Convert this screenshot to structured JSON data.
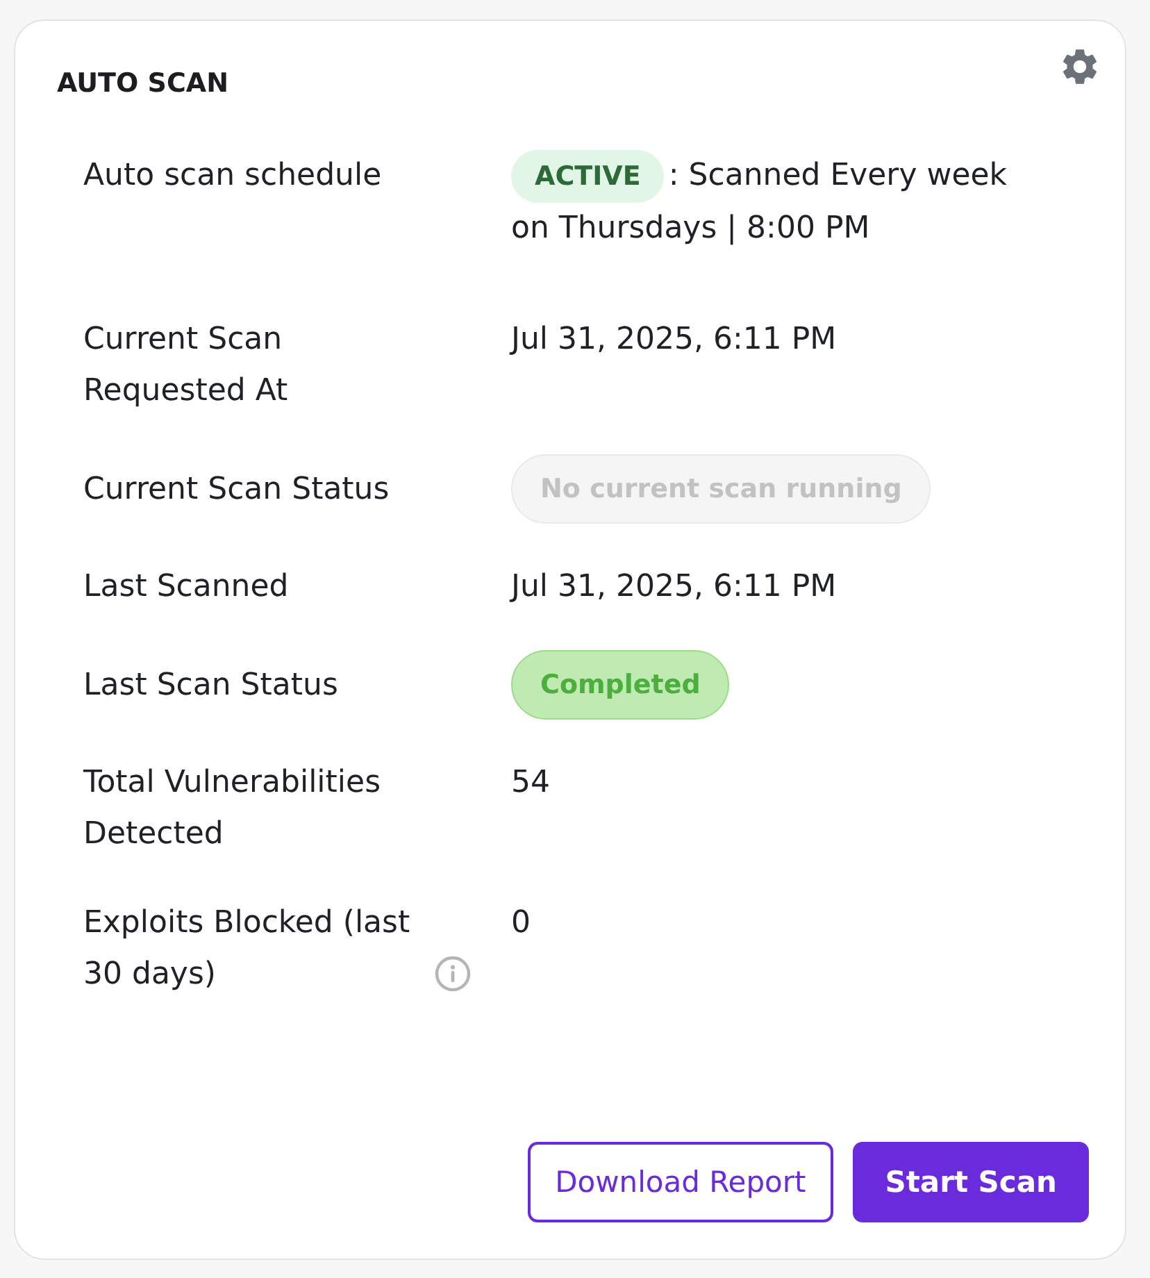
{
  "card": {
    "title": "AUTO SCAN"
  },
  "rows": [
    {
      "kind": "schedule",
      "label": "Auto scan schedule",
      "badge": "ACTIVE",
      "value": ": Scanned Every week on Thursdays | 8:00 PM",
      "info": false
    },
    {
      "kind": "text",
      "label": "Current Scan Requested At",
      "value": "Jul 31, 2025, 6:11 PM",
      "info": false
    },
    {
      "kind": "idle",
      "label": "Current Scan Status",
      "value": "No current scan running",
      "info": false
    },
    {
      "kind": "text",
      "label": "Last Scanned",
      "value": "Jul 31, 2025, 6:11 PM",
      "info": false
    },
    {
      "kind": "success",
      "label": "Last Scan Status",
      "value": "Completed",
      "info": false
    },
    {
      "kind": "text",
      "label": "Total Vulnerabilities Detected",
      "value": "54",
      "info": false
    },
    {
      "kind": "text",
      "label": "Exploits Blocked (last 30 days)",
      "value": "0",
      "info": true
    }
  ],
  "buttons": [
    {
      "kind": "outline",
      "label": "Download Report"
    },
    {
      "kind": "primary",
      "label": "Start Scan"
    }
  ]
}
